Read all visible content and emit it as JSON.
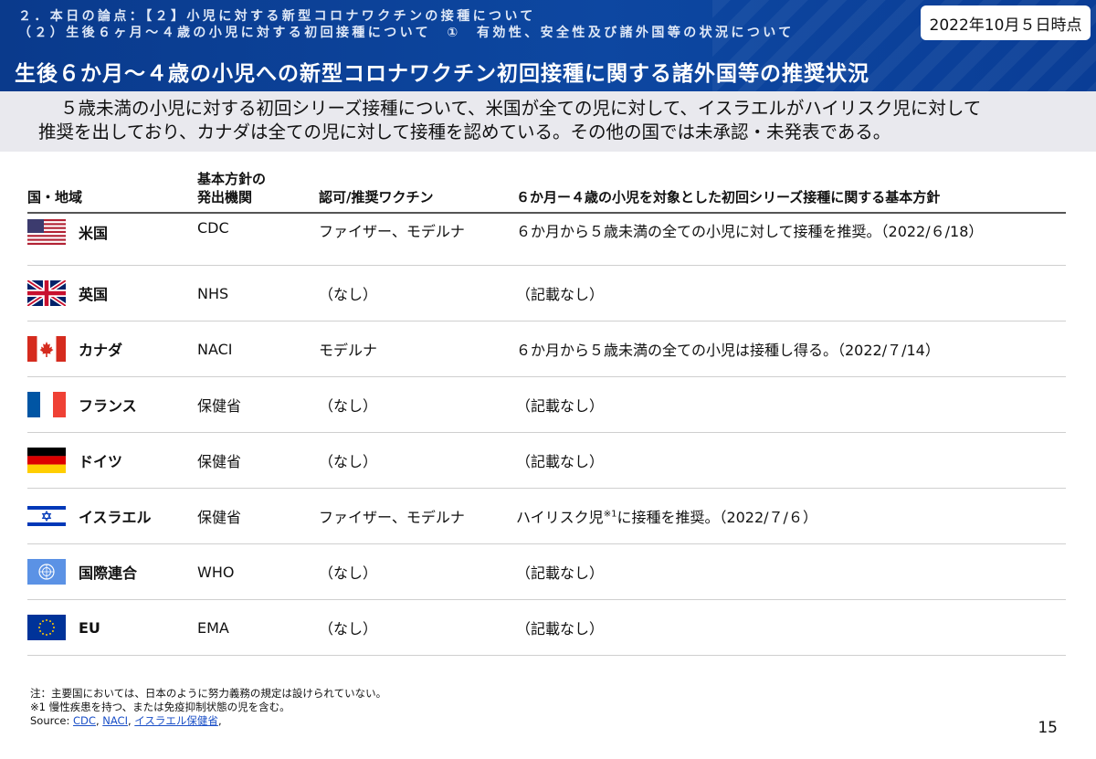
{
  "header": {
    "breadcrumb_line1": "２．本日の論点：【２】小児に対する新型コロナワクチンの接種について",
    "breadcrumb_line2": "（２）生後６ヶ月～４歳の小児に対する初回接種について　①　有効性、安全性及び諸外国等の状況について",
    "date_badge": "2022年10月５日時点",
    "title": "生後６か月～４歳の小児への新型コロナワクチン初回接種に関する諸外国等の推奨状況",
    "bg_color": "#0d47a1"
  },
  "summary": {
    "line1": "５歳未満の小児に対する初回シリーズ接種について、米国が全ての児に対して、イスラエルがハイリスク児に対して",
    "line2": "推奨を出しており、カナダは全ての児に対して接種を認めている。その他の国では未承認・未発表である。"
  },
  "table": {
    "headers": {
      "country": "国・地域",
      "agency_line1": "基本方針の",
      "agency_line2": "発出機関",
      "vaccine": "認可/推奨ワクチン",
      "policy": "６か月ー４歳の小児を対象とした初回シリーズ接種に関する基本方針"
    },
    "rows": [
      {
        "flag": "us-flag-icon",
        "country": "米国",
        "agency": "CDC",
        "vaccine": "ファイザー、モデルナ",
        "policy": "６か月から５歳未満の全ての小児に対して接種を推奨。（2022/６/18）"
      },
      {
        "flag": "uk-flag-icon",
        "country": "英国",
        "agency": "NHS",
        "vaccine": "（なし）",
        "policy": "（記載なし）"
      },
      {
        "flag": "canada-flag-icon",
        "country": "カナダ",
        "agency": "NACI",
        "vaccine": "モデルナ",
        "policy": "６か月から５歳未満の全ての小児は接種し得る。（2022/７/14）"
      },
      {
        "flag": "france-flag-icon",
        "country": "フランス",
        "agency": "保健省",
        "vaccine": "（なし）",
        "policy": "（記載なし）"
      },
      {
        "flag": "germany-flag-icon",
        "country": "ドイツ",
        "agency": "保健省",
        "vaccine": "（なし）",
        "policy": "（記載なし）"
      },
      {
        "flag": "israel-flag-icon",
        "country": "イスラエル",
        "agency": "保健省",
        "vaccine": "ファイザー、モデルナ",
        "policy_a": "ハイリスク児",
        "policy_sup": "※1",
        "policy_b": "に接種を推奨。（2022/７/６）"
      },
      {
        "flag": "un-flag-icon",
        "country": "国際連合",
        "agency": "WHO",
        "vaccine": "（なし）",
        "policy": "（記載なし）"
      },
      {
        "flag": "eu-flag-icon",
        "country": "EU",
        "agency": "EMA",
        "vaccine": "（なし）",
        "policy": "（記載なし）"
      }
    ]
  },
  "footnotes": {
    "note1": "注：主要国においては、日本のように努力義務の規定は設けられていない。",
    "note2": "※1 慢性疾患を持つ、または免疫抑制状態の児を含む。",
    "source_label": "Source: ",
    "source_links": [
      "CDC",
      "NACI",
      "イスラエル保健省"
    ],
    "sep": ", ",
    "trail": ","
  },
  "page_number": "15"
}
